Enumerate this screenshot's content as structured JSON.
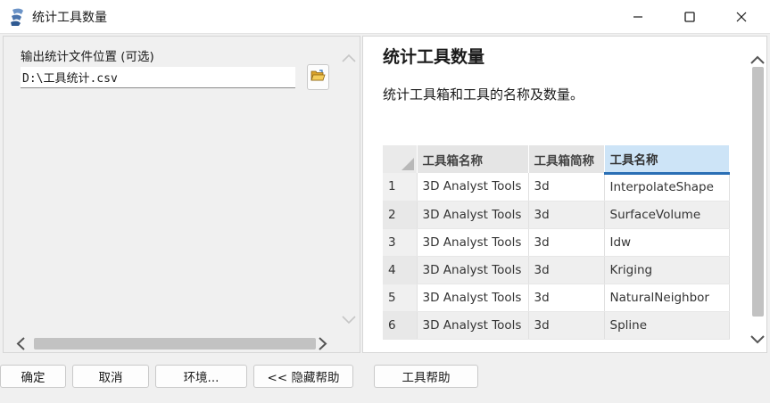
{
  "window": {
    "title": "统计工具数量"
  },
  "left": {
    "field_label": "输出统计文件位置 (可选)",
    "output_path": "D:\\工具统计.csv"
  },
  "help": {
    "title": "统计工具数量",
    "description": "统计工具箱和工具的名称及数量。",
    "table": {
      "headers": [
        "工具箱名称",
        "工具箱简称",
        "工具名称"
      ],
      "rows": [
        {
          "index": "1",
          "toolbox": "3D Analyst Tools",
          "alias": "3d",
          "tool": "InterpolateShape"
        },
        {
          "index": "2",
          "toolbox": "3D Analyst Tools",
          "alias": "3d",
          "tool": "SurfaceVolume"
        },
        {
          "index": "3",
          "toolbox": "3D Analyst Tools",
          "alias": "3d",
          "tool": "Idw"
        },
        {
          "index": "4",
          "toolbox": "3D Analyst Tools",
          "alias": "3d",
          "tool": "Kriging"
        },
        {
          "index": "5",
          "toolbox": "3D Analyst Tools",
          "alias": "3d",
          "tool": "NaturalNeighbor"
        },
        {
          "index": "6",
          "toolbox": "3D Analyst Tools",
          "alias": "3d",
          "tool": "Spline"
        }
      ]
    }
  },
  "footer": {
    "ok": "确定",
    "cancel": "取消",
    "environments": "环境...",
    "hide_help": "<< 隐藏帮助",
    "tool_help": "工具帮助"
  },
  "colors": {
    "selected_header": "#cde4f7",
    "selected_header_underline": "#2a6fb5",
    "folder_icon": "#e8b339"
  },
  "icons": [
    "app-icon",
    "minimize-icon",
    "maximize-icon",
    "close-icon",
    "folder-open-icon",
    "scroll-up-icon",
    "scroll-down-icon",
    "scroll-left-icon",
    "scroll-right-icon"
  ]
}
